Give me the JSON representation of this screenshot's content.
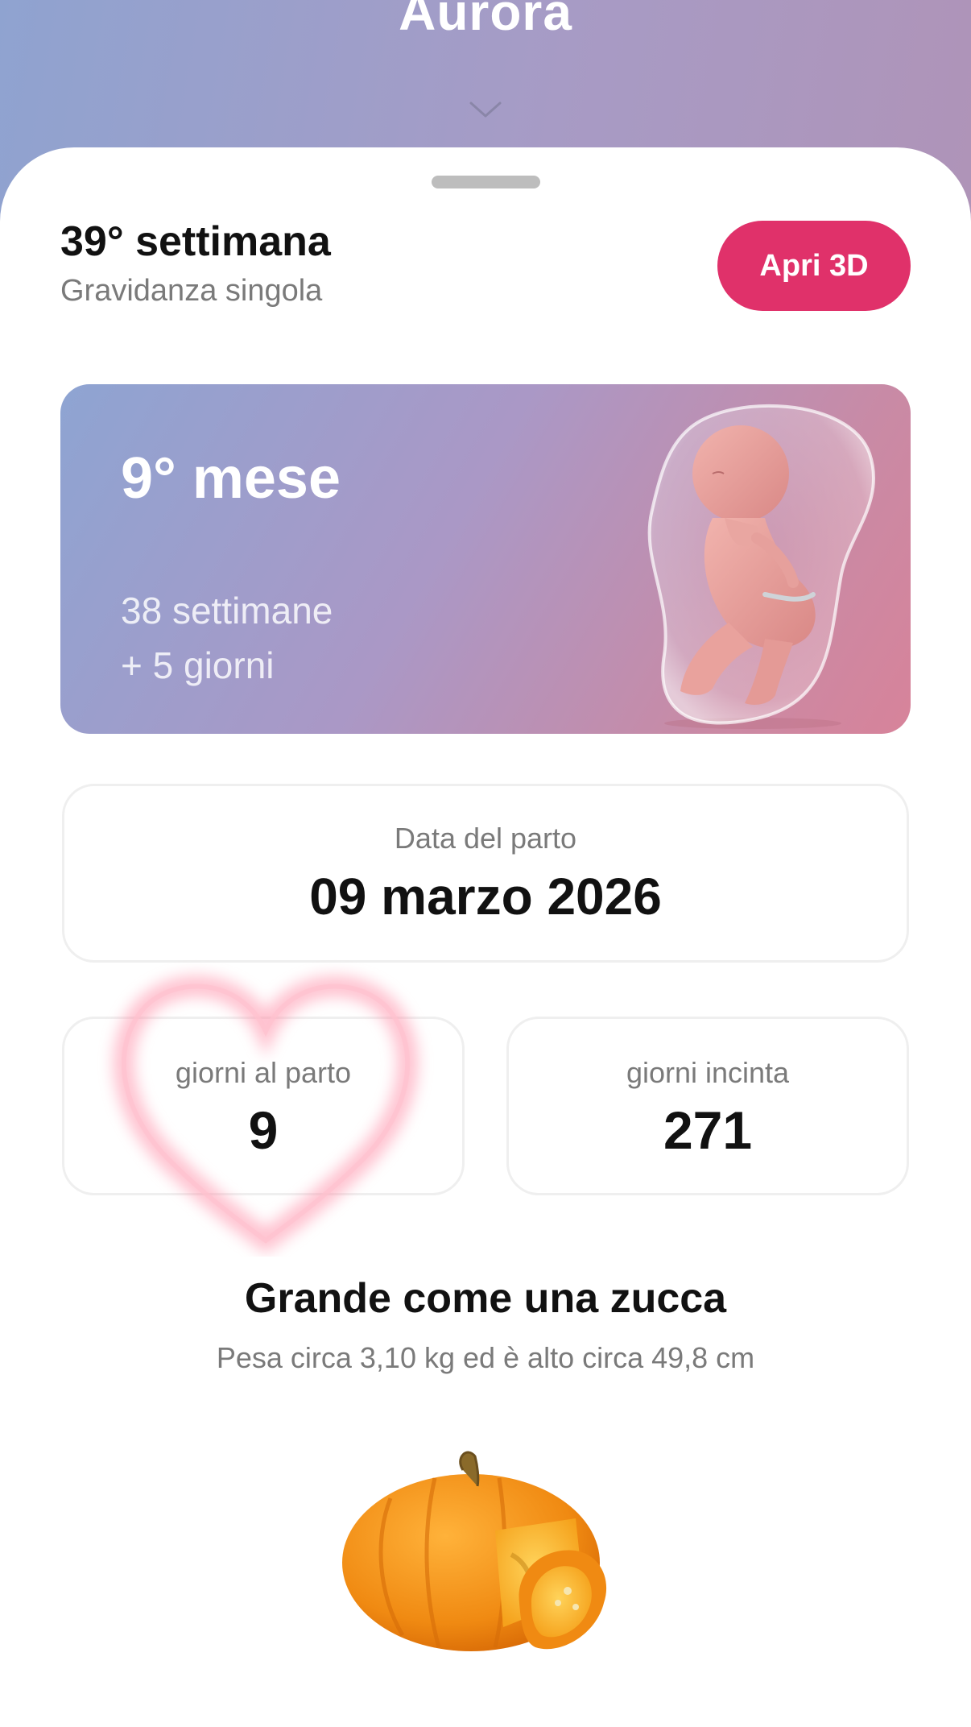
{
  "header": {
    "title": "Aurora",
    "chevron_icon": "chevron-down-icon"
  },
  "week": {
    "title": "39° settimana",
    "subtitle": "Gravidanza singola",
    "open_3d_label": "Apri 3D"
  },
  "month_card": {
    "title": "9° mese",
    "weeks_line": "38 settimane",
    "days_line": "+ 5 giorni",
    "illustration": "fetus-illustration"
  },
  "due_date": {
    "label": "Data del parto",
    "value": "09 marzo 2026"
  },
  "stats": [
    {
      "label": "giorni al parto",
      "value": "9"
    },
    {
      "label": "giorni incinta",
      "value": "271"
    }
  ],
  "size": {
    "title": "Grande come una zucca",
    "subtitle": "Pesa circa 3,10 kg ed è alto circa 49,8 cm",
    "illustration": "pumpkin-illustration"
  },
  "colors": {
    "accent": "#e0316a",
    "gradient_start": "#8fa3d0",
    "gradient_end": "#d7839a"
  }
}
